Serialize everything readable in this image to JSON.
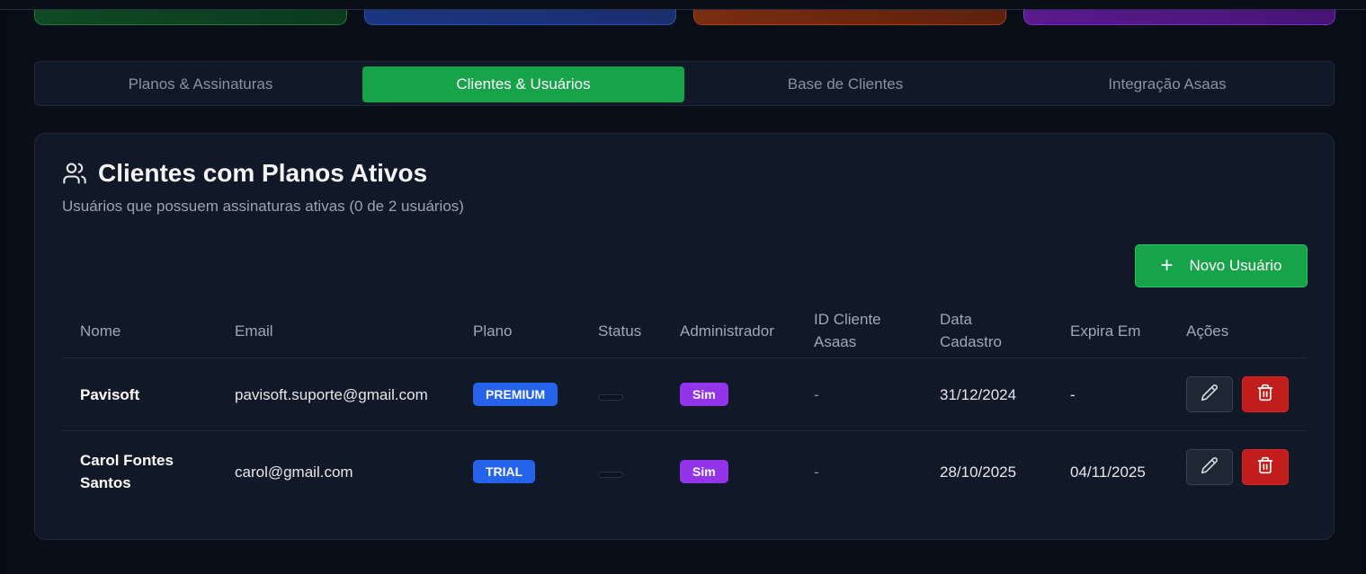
{
  "tabs": [
    {
      "label": "Planos & Assinaturas",
      "active": false
    },
    {
      "label": "Clientes & Usuários",
      "active": true
    },
    {
      "label": "Base de Clientes",
      "active": false
    },
    {
      "label": "Integração Asaas",
      "active": false
    }
  ],
  "panel": {
    "title": "Clientes com Planos Ativos",
    "subtitle": "Usuários que possuem assinaturas ativas (0 de 2 usuários)",
    "title_icon": "users-icon",
    "new_button": {
      "label": "Novo Usuário",
      "icon": "plus-icon"
    }
  },
  "table": {
    "headers": {
      "nome": "Nome",
      "email": "Email",
      "plano": "Plano",
      "status": "Status",
      "admin": "Administrador",
      "id_line1": "ID Cliente",
      "id_line2": "Asaas",
      "data_line1": "Data",
      "data_line2": "Cadastro",
      "expira": "Expira Em",
      "acoes": "Ações"
    },
    "rows": [
      {
        "nome_line1": "Pavisoft",
        "nome_line2": "",
        "email": "pavisoft.suporte@gmail.com",
        "plano": "PREMIUM",
        "admin": "Sim",
        "asaas_id": "-",
        "data_cadastro": "31/12/2024",
        "expira_em": "-"
      },
      {
        "nome_line1": "Carol Fontes",
        "nome_line2": "Santos",
        "email": "carol@gmail.com",
        "plano": "TRIAL",
        "admin": "Sim",
        "asaas_id": "-",
        "data_cadastro": "28/10/2025",
        "expira_em": "04/11/2025"
      }
    ]
  },
  "colors": {
    "accent_green": "#16a34a",
    "badge_blue": "#2563eb",
    "badge_purple": "#9333ea",
    "danger_red": "#c11d1d"
  }
}
